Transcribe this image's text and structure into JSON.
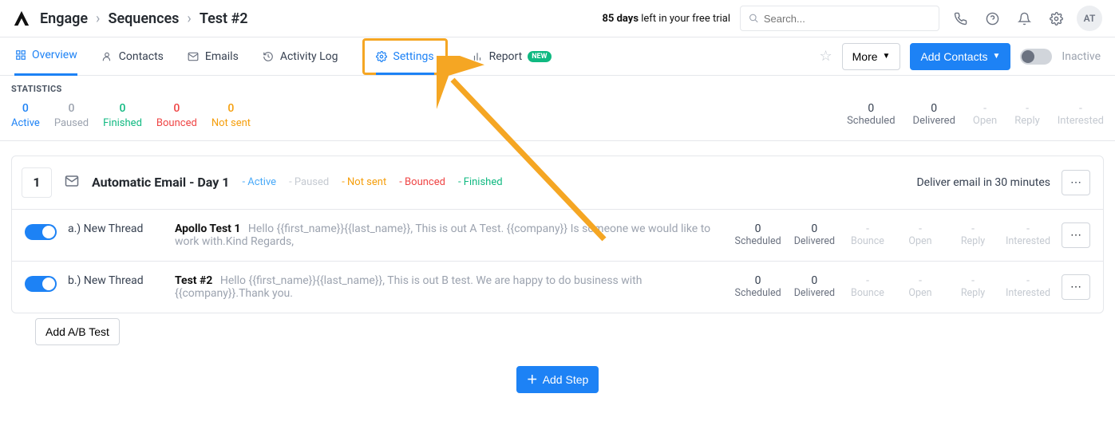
{
  "header": {
    "breadcrumb": [
      "Engage",
      "Sequences",
      "Test #2"
    ],
    "trial_days": "85 days",
    "trial_text": " left in your free trial",
    "search_placeholder": "Search...",
    "avatar": "AT"
  },
  "tabs": {
    "overview": "Overview",
    "contacts": "Contacts",
    "emails": "Emails",
    "activity": "Activity Log",
    "settings": "Settings",
    "report": "Report",
    "report_badge": "NEW",
    "more_btn": "More",
    "add_contacts_btn": "Add Contacts",
    "inactive_label": "Inactive"
  },
  "stats": {
    "title": "STATISTICS",
    "left": {
      "active": {
        "value": "0",
        "label": "Active"
      },
      "paused": {
        "value": "0",
        "label": "Paused"
      },
      "finished": {
        "value": "0",
        "label": "Finished"
      },
      "bounced": {
        "value": "0",
        "label": "Bounced"
      },
      "notsent": {
        "value": "0",
        "label": "Not sent"
      }
    },
    "right": {
      "scheduled": {
        "value": "0",
        "label": "Scheduled"
      },
      "delivered": {
        "value": "0",
        "label": "Delivered"
      },
      "open": {
        "value": "-",
        "label": "Open"
      },
      "reply": {
        "value": "-",
        "label": "Reply"
      },
      "interested": {
        "value": "-",
        "label": "Interested"
      }
    }
  },
  "step": {
    "number": "1",
    "title": "Automatic Email - Day 1",
    "pills": {
      "active": "- Active",
      "paused": "- Paused",
      "notsent": "- Not sent",
      "bounced": "- Bounced",
      "finished": "- Finished"
    },
    "deliver_text": "Deliver email in 30 minutes",
    "variants": [
      {
        "label": "a.) New Thread",
        "subject": "Apollo Test 1",
        "body": "Hello {{first_name}}{{last_name}}, This is out A Test. {{company}} Is someone we would like to work with.Kind Regards,",
        "metrics": {
          "scheduled": {
            "v": "0",
            "l": "Scheduled"
          },
          "delivered": {
            "v": "0",
            "l": "Delivered"
          },
          "bounce": {
            "v": "-",
            "l": "Bounce"
          },
          "open": {
            "v": "-",
            "l": "Open"
          },
          "reply": {
            "v": "-",
            "l": "Reply"
          },
          "interested": {
            "v": "-",
            "l": "Interested"
          }
        }
      },
      {
        "label": "b.) New Thread",
        "subject": "Test #2",
        "body": "Hello {{first_name}}{{last_name}}, This is out B test. We are happy to do business with {{company}}.Thank you.",
        "metrics": {
          "scheduled": {
            "v": "0",
            "l": "Scheduled"
          },
          "delivered": {
            "v": "0",
            "l": "Delivered"
          },
          "bounce": {
            "v": "-",
            "l": "Bounce"
          },
          "open": {
            "v": "-",
            "l": "Open"
          },
          "reply": {
            "v": "-",
            "l": "Reply"
          },
          "interested": {
            "v": "-",
            "l": "Interested"
          }
        }
      }
    ],
    "add_ab": "Add A/B Test",
    "add_step": "Add Step"
  }
}
